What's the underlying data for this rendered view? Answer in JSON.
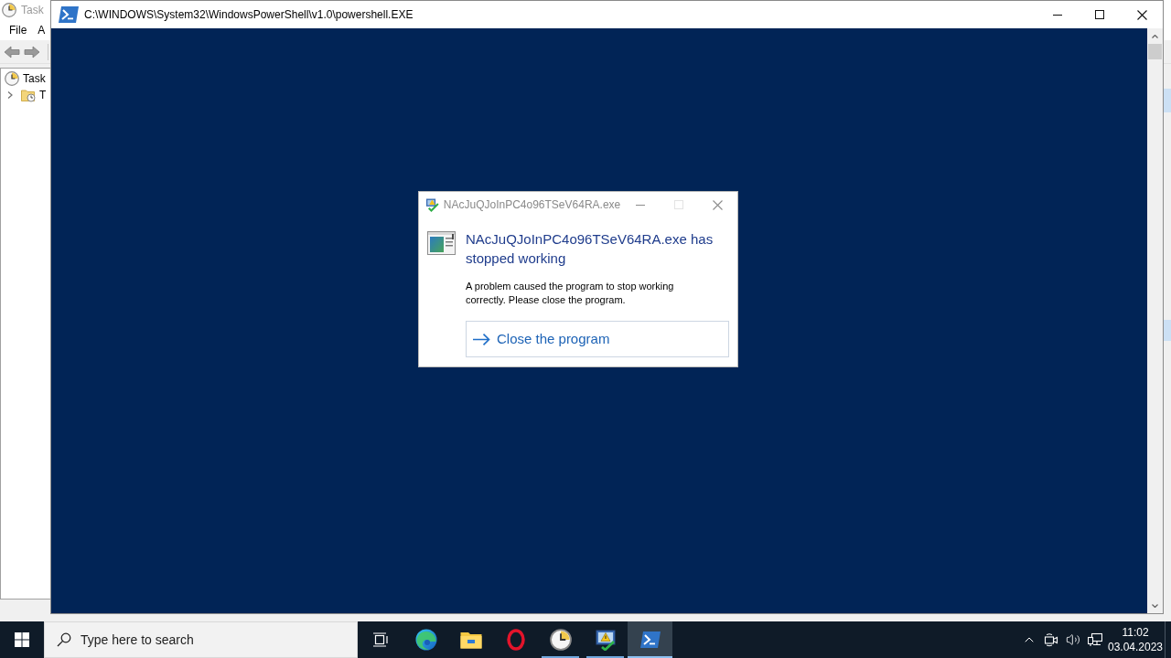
{
  "background_window": {
    "title": "Task",
    "menu": [
      "File",
      "A"
    ],
    "toolbar": [
      {
        "kind": "back"
      },
      {
        "kind": "forward"
      }
    ],
    "tree": [
      {
        "label": "Task",
        "children": [
          {
            "label": "T",
            "expanded": false
          }
        ]
      }
    ]
  },
  "console_window": {
    "title": "C:\\WINDOWS\\System32\\WindowsPowerShell\\v1.0\\powershell.EXE"
  },
  "dialog": {
    "title": "NAcJuQJoInPC4o96TSeV64RA.exe",
    "controls": [
      {
        "kind": "minimize",
        "disabled": false
      },
      {
        "kind": "maximize",
        "disabled": true
      },
      {
        "kind": "close",
        "disabled": false
      }
    ],
    "heading": "NAcJuQJoInPC4o96TSeV64RA.exe has stopped working",
    "message": "A problem caused the program to stop working correctly. Please close the program.",
    "action": "Close the program"
  },
  "taskbar": {
    "search": {
      "placeholder": "Type here to search"
    },
    "apps": [
      {
        "kind": "edge",
        "running": false,
        "active": false
      },
      {
        "kind": "explorer",
        "running": false,
        "active": false
      },
      {
        "kind": "opera",
        "running": false,
        "active": false
      },
      {
        "kind": "scheduler",
        "running": true,
        "active": false
      },
      {
        "kind": "monitor",
        "running": true,
        "active": false
      },
      {
        "kind": "powershell",
        "running": true,
        "active": true
      }
    ],
    "tray": {
      "time": "11:02",
      "date": "03.04.2023"
    }
  }
}
